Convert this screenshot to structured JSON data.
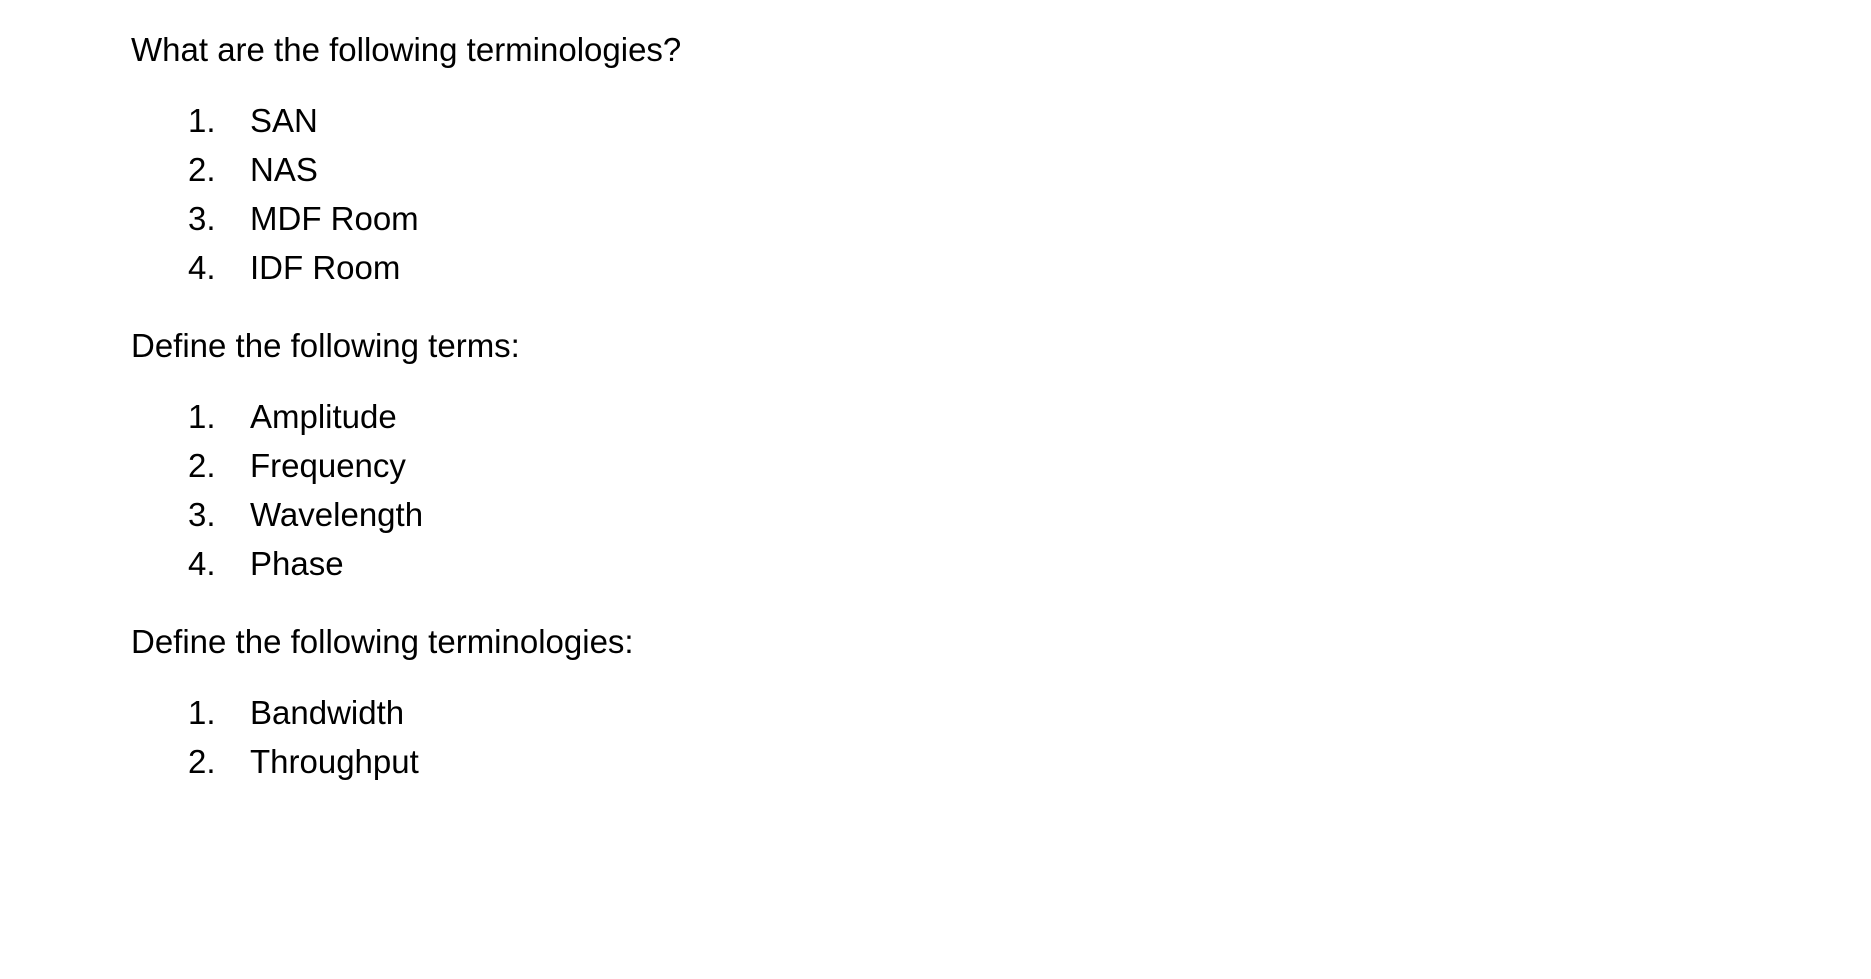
{
  "document": {
    "background_color": "#ffffff",
    "text_color": "#000000",
    "sections": [
      {
        "heading": "What are the following terminologies?",
        "items": [
          {
            "marker": "1.",
            "label": "SAN"
          },
          {
            "marker": "2.",
            "label": "NAS"
          },
          {
            "marker": "3.",
            "label": "MDF Room"
          },
          {
            "marker": "4.",
            "label": "IDF Room"
          }
        ]
      },
      {
        "heading": "Define the following terms:",
        "items": [
          {
            "marker": "1.",
            "label": "Amplitude"
          },
          {
            "marker": "2.",
            "label": "Frequency"
          },
          {
            "marker": "3.",
            "label": "Wavelength"
          },
          {
            "marker": "4.",
            "label": "Phase"
          }
        ]
      },
      {
        "heading": "Define the following terminologies:",
        "items": [
          {
            "marker": "1.",
            "label": "Bandwidth"
          },
          {
            "marker": "2.",
            "label": "Throughput"
          }
        ]
      }
    ]
  }
}
